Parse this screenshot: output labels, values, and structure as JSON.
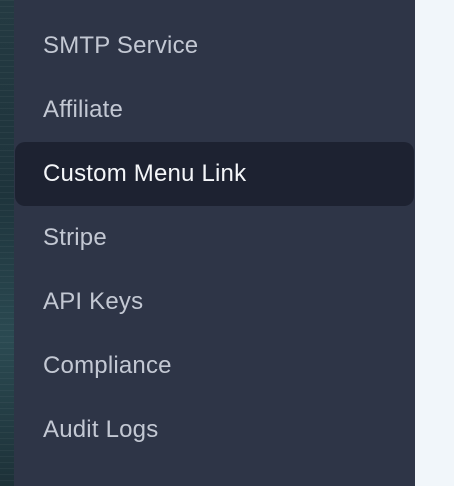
{
  "sidebar": {
    "active_index": 2,
    "items": [
      {
        "label": "SMTP Service"
      },
      {
        "label": "Affiliate"
      },
      {
        "label": "Custom Menu Link"
      },
      {
        "label": "Stripe"
      },
      {
        "label": "API Keys"
      },
      {
        "label": "Compliance"
      },
      {
        "label": "Audit Logs"
      }
    ]
  },
  "colors": {
    "sidebar_bg": "#2e3547",
    "active_item_bg": "#1d2231",
    "item_text": "#c3c8d3",
    "active_item_text": "#f4f6f9",
    "content_bg": "#f1f6fa"
  }
}
